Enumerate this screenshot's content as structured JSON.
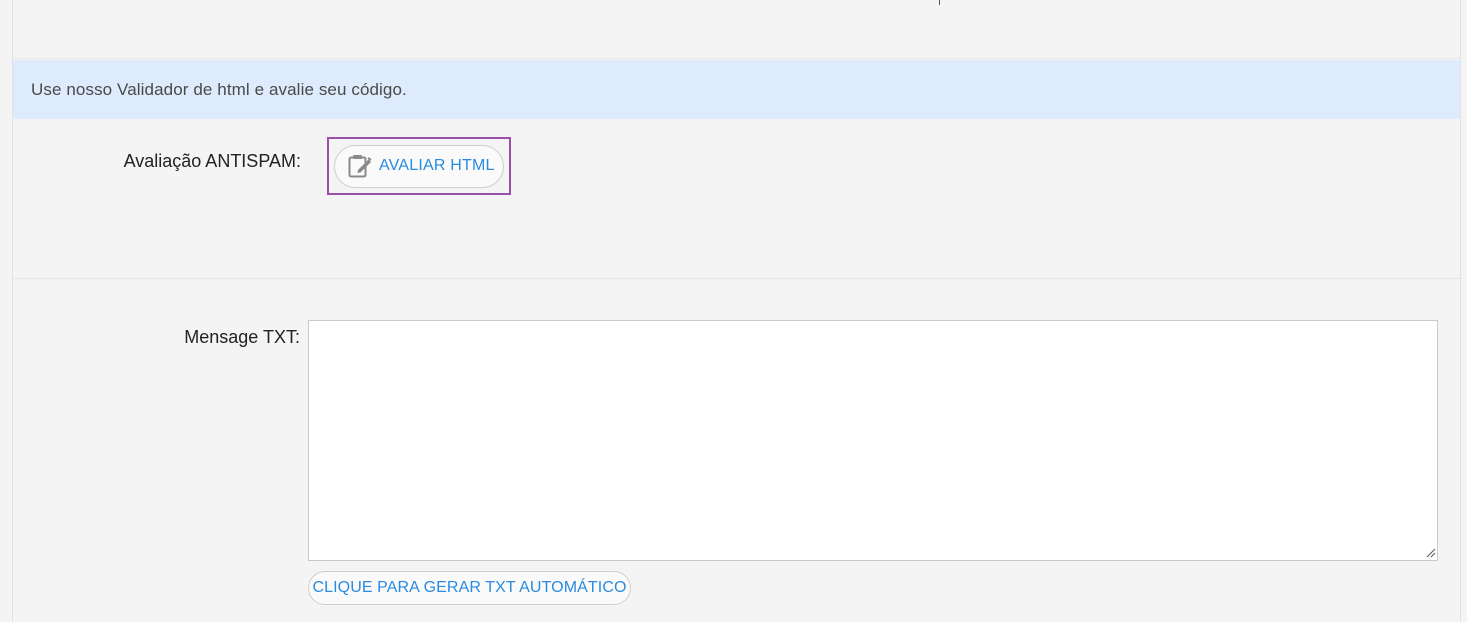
{
  "info_banner": {
    "text": "Use nosso Validador de html e avalie seu código."
  },
  "antispam": {
    "label": "Avaliação ANTISPAM:",
    "button_label": "AVALIAR HTML",
    "button_icon": "edit-clipboard-icon"
  },
  "message_txt": {
    "label": "Mensage TXT:",
    "value": "",
    "placeholder": ""
  },
  "generate_txt": {
    "button_label": "CLIQUE PARA GERAR TXT AUTOMÁTICO"
  },
  "colors": {
    "banner_bg": "#ddebfd",
    "link_blue": "#2a8be0",
    "focus_ring": "#9b4fa8",
    "page_bg": "#f4f4f4"
  }
}
